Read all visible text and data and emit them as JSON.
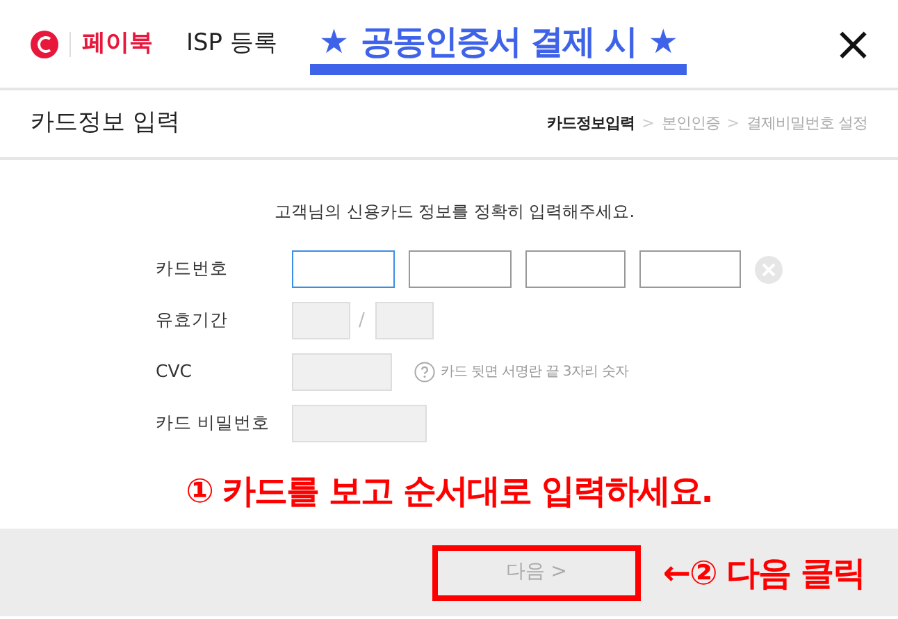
{
  "header": {
    "brand": "페이북",
    "title": "ISP 등록",
    "banner": {
      "star_left": "★",
      "text": "공동인증서 결제 시",
      "star_right": "★"
    },
    "close": "×"
  },
  "section": {
    "title": "카드정보 입력",
    "steps": [
      {
        "label": "카드정보입력",
        "selected": true
      },
      {
        "label": "본인인증",
        "selected": false
      },
      {
        "label": "결제비밀번호 설정",
        "selected": false
      }
    ],
    "separator": ">"
  },
  "instruction": "고객님의 신용카드 정보를 정확히 입력해주세요.",
  "form": [
    {
      "kind": "card",
      "label": "카드번호",
      "fields": [
        {
          "focused": true,
          "disabled": false
        },
        {
          "focused": false,
          "disabled": false
        },
        {
          "focused": false,
          "disabled": false
        },
        {
          "focused": false,
          "disabled": false
        }
      ]
    },
    {
      "kind": "expiry",
      "label": "유효기간",
      "separator": "/",
      "fields": [
        {
          "focused": false,
          "disabled": true
        },
        {
          "focused": false,
          "disabled": true
        }
      ]
    },
    {
      "kind": "cvc",
      "label": "CVC",
      "hint": "카드 뒷면 서명란 끝 3자리 숫자",
      "fields": [
        {
          "focused": false,
          "disabled": true
        }
      ]
    },
    {
      "kind": "password",
      "label": "카드 비밀번호",
      "fields": [
        {
          "focused": false,
          "disabled": true
        }
      ]
    }
  ],
  "annotation_1": {
    "mark": "①",
    "text": "카드를 보고 순서대로 입력하세요."
  },
  "footer": {
    "next_button": {
      "label": "다음 >",
      "disabled": true,
      "highlighted": true
    },
    "annotation_2": {
      "arrow": "←",
      "mark": "②",
      "text": "다음 클릭"
    }
  }
}
